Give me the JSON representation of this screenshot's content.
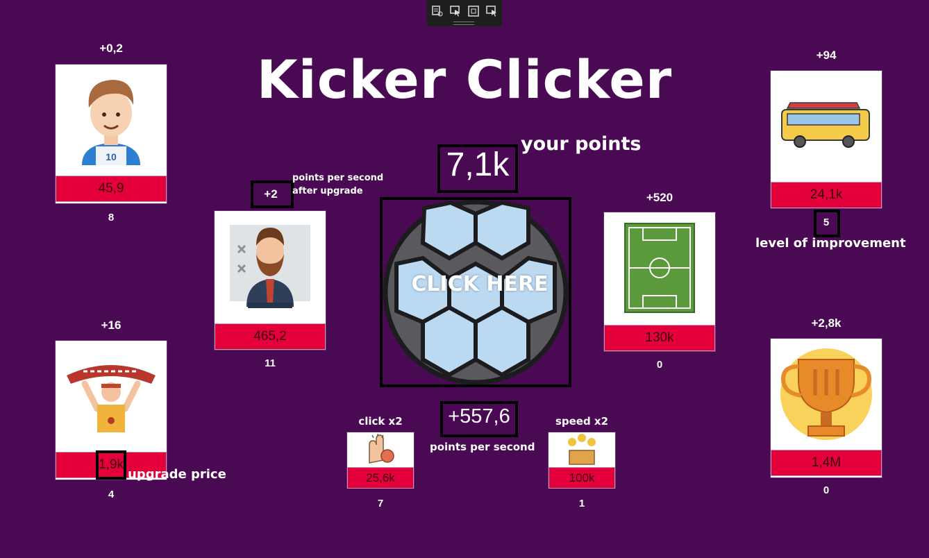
{
  "title": "Kicker Clicker",
  "score": {
    "value": "7,1k",
    "label": "your points"
  },
  "ball": {
    "label": "CLICK HERE"
  },
  "rate": {
    "value": "+557,6",
    "label": "points per second"
  },
  "annotations": {
    "pps_after_line1": "points per second",
    "pps_after_line2": "after upgrade",
    "level_label": "level of improvement",
    "price_label": "upgrade price"
  },
  "upgrades": [
    {
      "id": "player",
      "gain": "+0,2",
      "price": "45,9",
      "level": "8",
      "icon": "player-icon"
    },
    {
      "id": "coach",
      "gain": "+2",
      "price": "465,2",
      "level": "11",
      "icon": "coach-icon"
    },
    {
      "id": "fan",
      "gain": "+16",
      "price": "1,9k",
      "level": "4",
      "icon": "fan-icon"
    },
    {
      "id": "bus",
      "gain": "+94",
      "price": "24,1k",
      "level": "5",
      "icon": "bus-icon"
    },
    {
      "id": "stadium",
      "gain": "+520",
      "price": "130k",
      "level": "0",
      "icon": "stadium-icon"
    },
    {
      "id": "trophy",
      "gain": "+2,8k",
      "price": "1,4M",
      "level": "0",
      "icon": "trophy-icon"
    }
  ],
  "boosts": [
    {
      "id": "click",
      "label": "click x2",
      "price": "25,6k",
      "level": "7",
      "icon": "click-hand-icon"
    },
    {
      "id": "speed",
      "label": "speed x2",
      "price": "100k",
      "level": "1",
      "icon": "money-box-icon"
    }
  ],
  "colors": {
    "background": "#4a0a53",
    "price_bar": "#e4003a"
  }
}
